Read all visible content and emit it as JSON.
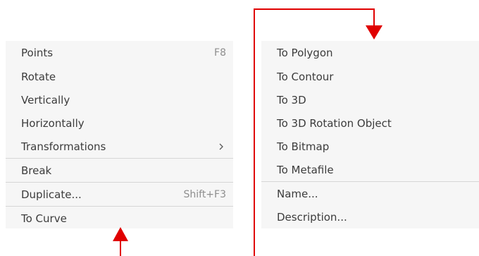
{
  "left_menu": {
    "items": [
      {
        "label": "Points",
        "shortcut": "F8"
      },
      {
        "label": "Rotate"
      },
      {
        "label": "Vertically"
      },
      {
        "label": "Horizontally"
      },
      {
        "label": "Transformations",
        "submenu_icon": "chevron-right-icon"
      },
      {
        "label": "Break"
      },
      {
        "label": "Duplicate...",
        "shortcut": "Shift+F3"
      },
      {
        "label": "To Curve"
      }
    ]
  },
  "right_menu": {
    "items": [
      {
        "label": "To Polygon"
      },
      {
        "label": "To Contour"
      },
      {
        "label": "To 3D"
      },
      {
        "label": "To 3D Rotation Object"
      },
      {
        "label": "To Bitmap"
      },
      {
        "label": "To Metafile"
      },
      {
        "label": "Name..."
      },
      {
        "label": "Description..."
      }
    ]
  },
  "annotation": {
    "color": "#e00000",
    "icons": [
      "up-arrow-icon",
      "down-arrow-icon"
    ]
  }
}
